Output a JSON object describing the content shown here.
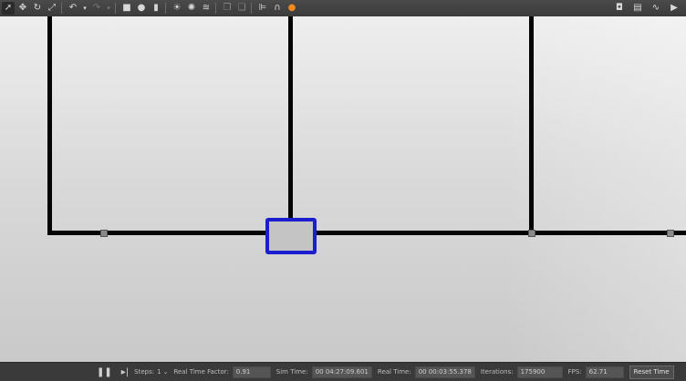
{
  "toolbar": {
    "left_icons": [
      "select-icon",
      "translate-icon",
      "rotate-icon",
      "scale-icon",
      "undo-icon",
      "redo-icon",
      "box-icon",
      "sphere-icon",
      "cylinder-icon",
      "point-light-icon",
      "spot-light-icon",
      "directional-light-icon",
      "copy-icon",
      "paste-icon",
      "align-icon",
      "snap-icon",
      "select-model-icon"
    ],
    "right_icons": [
      "screenshot-icon",
      "log-icon",
      "plot-icon",
      "video-icon"
    ]
  },
  "statusbar": {
    "steps_label": "Steps:",
    "steps_value": "1",
    "rtf_label": "Real Time Factor:",
    "rtf_value": "0.91",
    "sim_label": "Sim Time:",
    "sim_value": "00 04:27:09.601",
    "real_label": "Real Time:",
    "real_value": "00 00:03:55.378",
    "iter_label": "Iterations:",
    "iter_value": "175900",
    "fps_label": "FPS:",
    "fps_value": "62.71",
    "reset_label": "Reset Time"
  },
  "colors": {
    "robot": "#1d1dd0",
    "wall": "#050505",
    "toolbar": "#3b3b3b"
  }
}
